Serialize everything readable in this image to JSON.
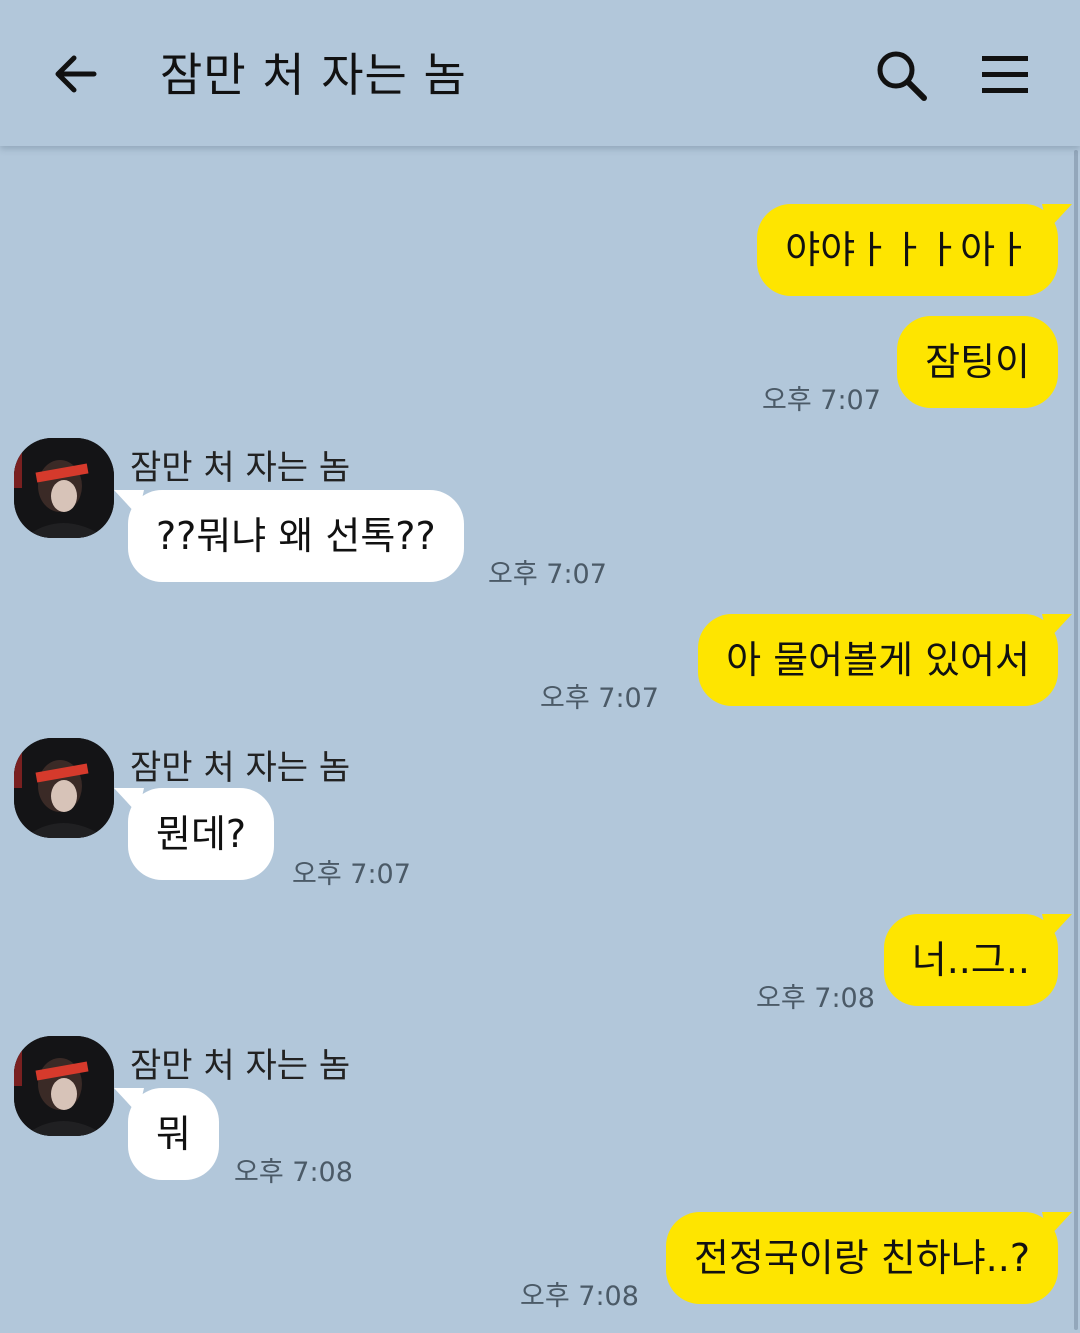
{
  "header": {
    "title": "잠만 처 자는 놈",
    "back_icon": "arrow-left-icon",
    "search_icon": "search-icon",
    "menu_icon": "hamburger-menu-icon"
  },
  "colors": {
    "background": "#b2c7da",
    "my_bubble": "#fee500",
    "their_bubble": "#ffffff"
  },
  "messages": [
    {
      "side": "me",
      "text": "야야ㅏㅏㅏ아ㅏ",
      "time": ""
    },
    {
      "side": "me",
      "text": "잠팅이",
      "time": "오후 7:07"
    },
    {
      "side": "them",
      "sender": "잠만 처 자는 놈",
      "text": "??뭐냐 왜 선톡??",
      "time": "오후 7:07"
    },
    {
      "side": "me",
      "text": "아 물어볼게 있어서",
      "time": "오후 7:07"
    },
    {
      "side": "them",
      "sender": "잠만 처 자는 놈",
      "text": "뭔데?",
      "time": "오후 7:07"
    },
    {
      "side": "me",
      "text": "너..그..",
      "time": "오후 7:08"
    },
    {
      "side": "them",
      "sender": "잠만 처 자는 놈",
      "text": "뭐",
      "time": "오후 7:08"
    },
    {
      "side": "me",
      "text": "전정국이랑 친하냐..?",
      "time": "오후 7:08"
    }
  ]
}
